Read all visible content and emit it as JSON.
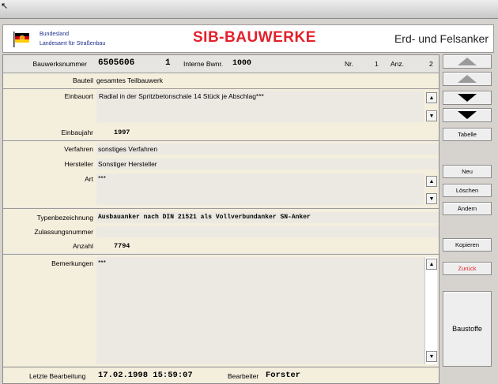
{
  "header": {
    "org_line1": "Bundesland",
    "org_line2": "Landesamt für Straßenbau",
    "app_title": "SIB-BAUWERKE",
    "module_title": "Erd- und Felsanker"
  },
  "top": {
    "bauwerksnummer_label": "Bauwerksnummer",
    "bauwerksnummer": "6505606",
    "teil": "1",
    "interne_label": "Interne Bwnr.",
    "interne": "1000",
    "nr_label": "Nr.",
    "nr": "1",
    "anz_label": "Anz.",
    "anz": "2"
  },
  "form": {
    "bauteil_label": "Bauteil",
    "bauteil": "gesamtes Teilbauwerk",
    "einbauort_label": "Einbauort",
    "einbauort": "Radial in der Spritzbetonschale 14 Stück je Abschlag***",
    "einbaujahr_label": "Einbaujahr",
    "einbaujahr": "1997",
    "verfahren_label": "Verfahren",
    "verfahren": "sonstiges Verfahren",
    "hersteller_label": "Hersteller",
    "hersteller": "Sonstiger Hersteller",
    "art_label": "Art",
    "art": "***",
    "typ_label": "Typenbezeichnung",
    "typ": "Ausbauanker nach DIN 21521 als Vollverbundanker SN-Anker",
    "zulassung_label": "Zulassungsnummer",
    "zulassung": "",
    "anzahl_label": "Anzahl",
    "anzahl": "7794",
    "bemerkungen_label": "Bemerkungen",
    "bemerkungen": "***"
  },
  "footer": {
    "letzte_label": "Letzte Bearbeitung",
    "letzte": "17.02.1998 15:59:07",
    "bearbeiter_label": "Bearbeiter",
    "bearbeiter": "Forster"
  },
  "sidebar": {
    "tabelle": "Tabelle",
    "neu": "Neu",
    "loeschen": "Löschen",
    "aendern": "Ändern",
    "kopieren": "Kopieren",
    "zurueck": "Zurück",
    "baustoffe": "Baustoffe"
  },
  "colors": {
    "title_red": "#e4202a",
    "org_blue": "#1a2e8a",
    "zurueck_red": "#e4202a"
  }
}
